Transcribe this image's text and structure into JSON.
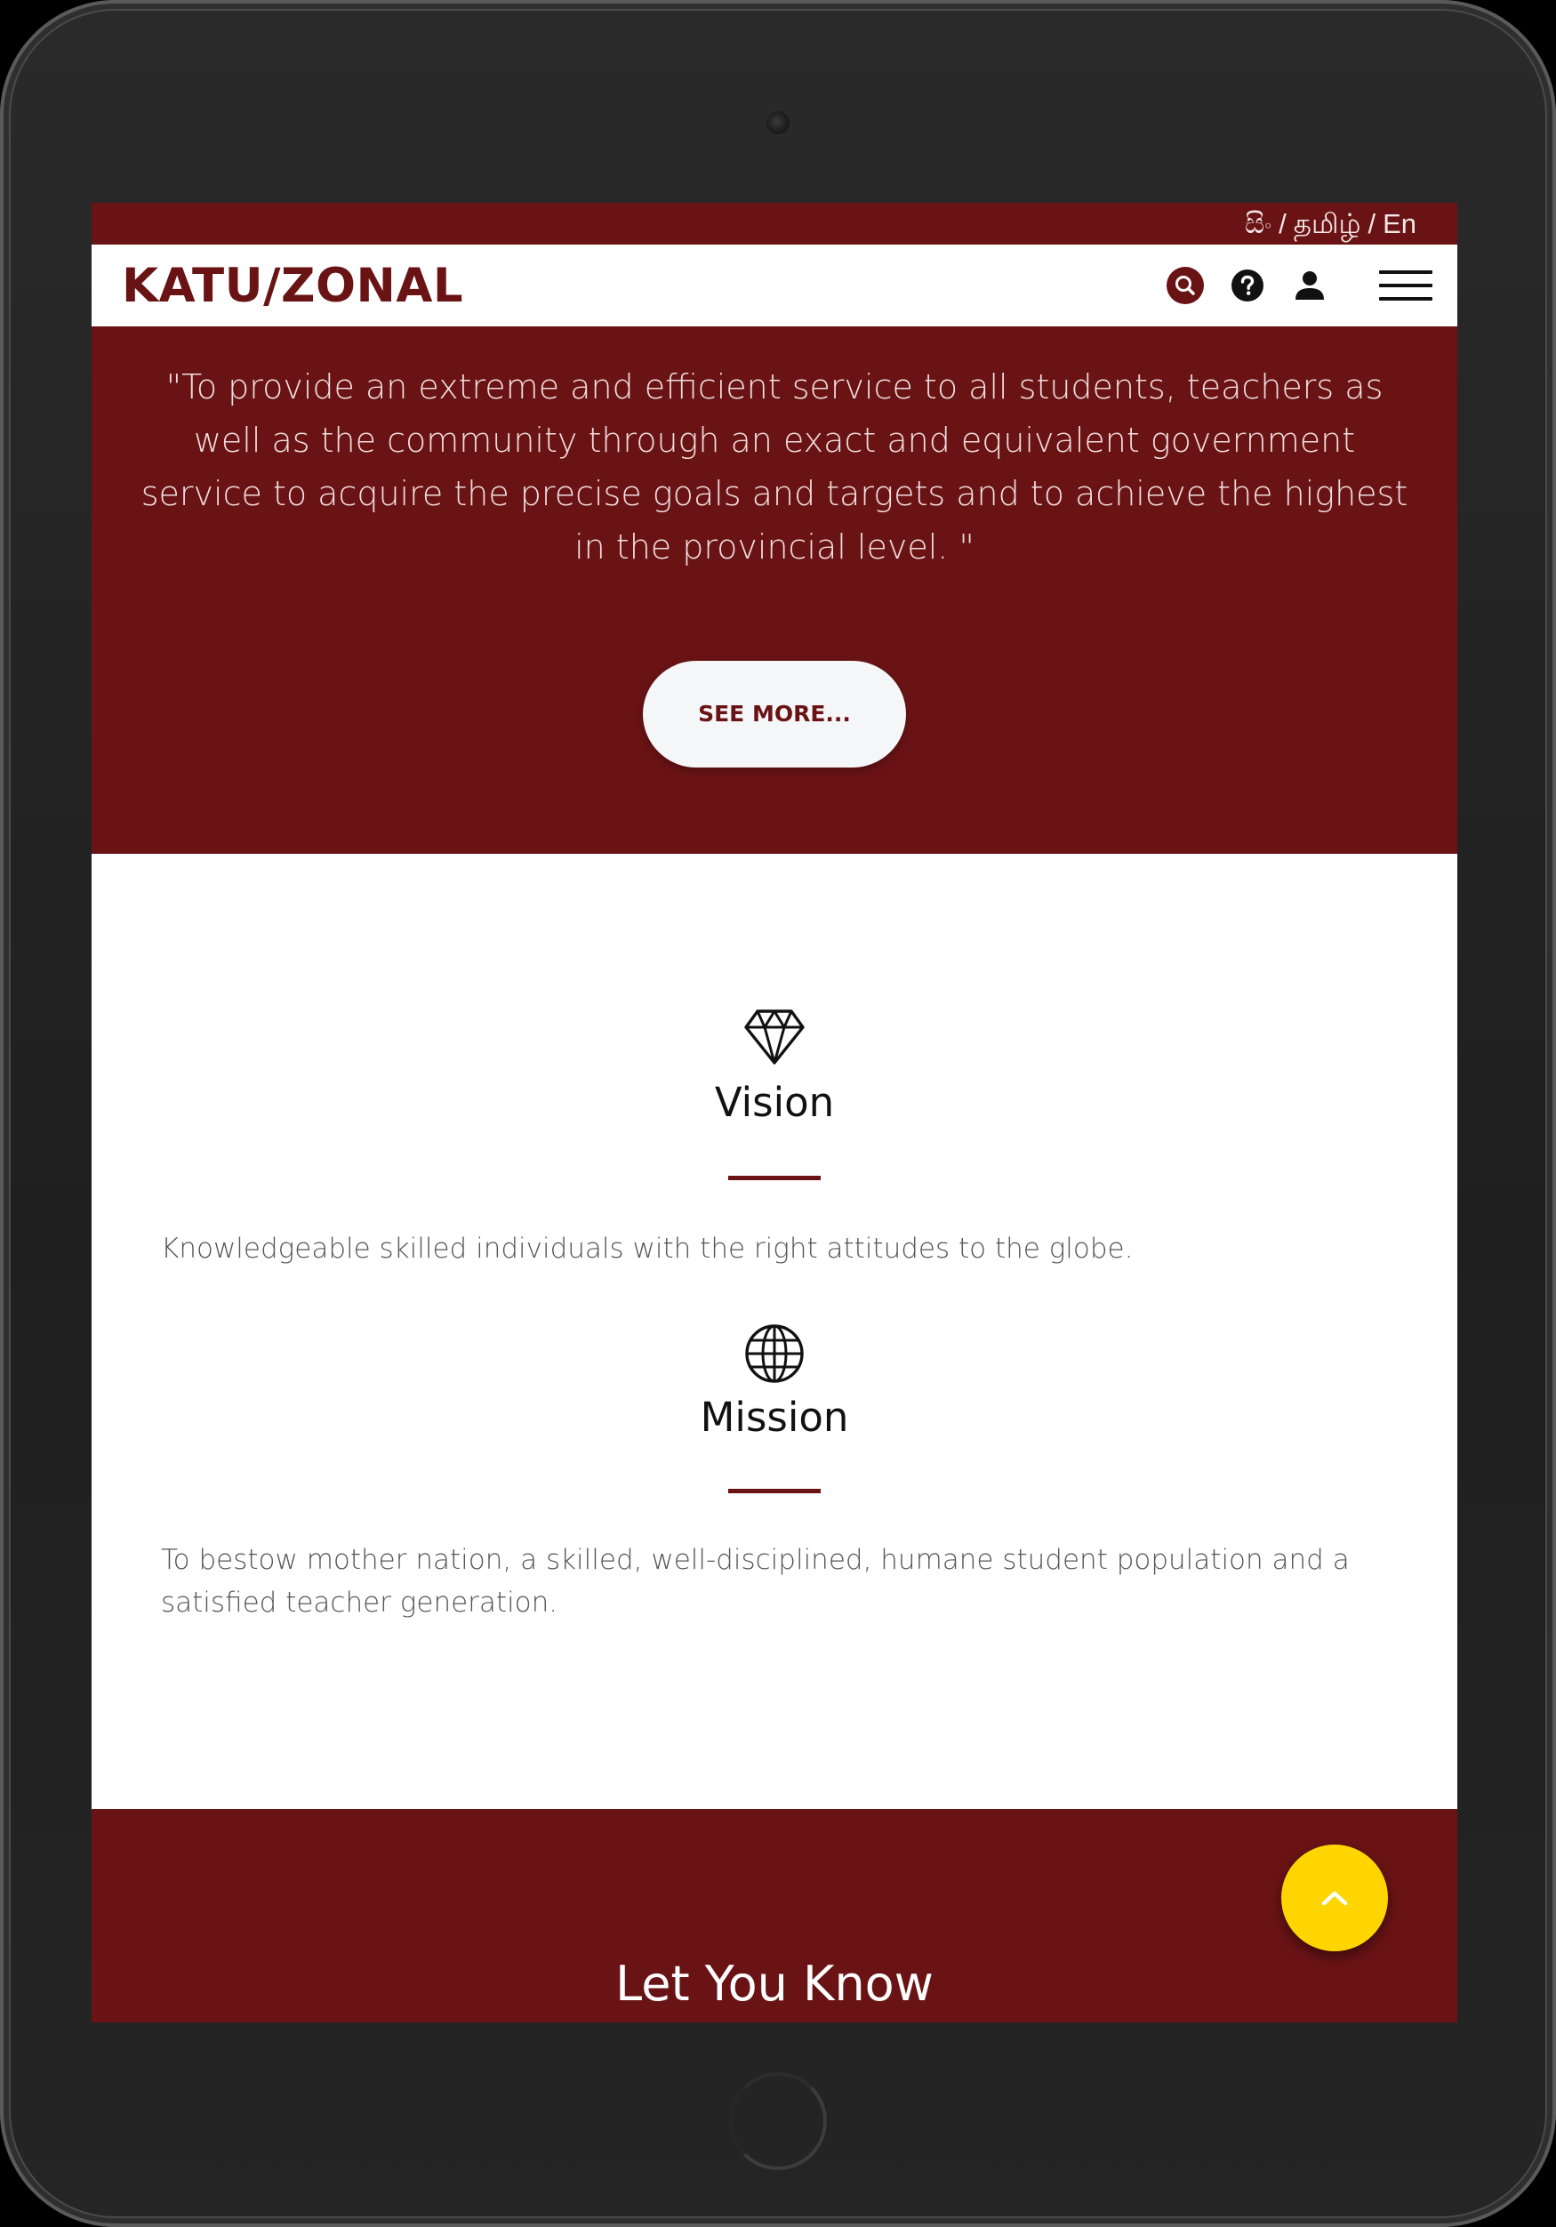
{
  "language_switcher": {
    "sinhala": "සිං",
    "tamil": "தமிழ்",
    "english": "En",
    "separator": "/"
  },
  "navbar": {
    "brand": "KATU/ZONAL",
    "icons": [
      "search-icon",
      "help-icon",
      "user-icon",
      "hamburger-menu-icon"
    ]
  },
  "hero": {
    "quote": "\"To provide an extreme and efficient service to all students, teachers as well as the community through an exact and equivalent government service to acquire the precise goals and targets and to achieve the highest in the provincial level. \"",
    "button_label": "SEE MORE..."
  },
  "vision": {
    "icon": "diamond-icon",
    "title": "Vision",
    "text": "Knowledgeable skilled individuals with the right attitudes to the globe."
  },
  "mission": {
    "icon": "globe-icon",
    "title": "Mission",
    "text": "To bestow mother nation, a skilled, well-disciplined, humane student population and a satisfied teacher generation."
  },
  "let_you_know": {
    "title": "Let You Know"
  },
  "scroll_top": {
    "icon": "chevron-up-icon"
  },
  "colors": {
    "brand_maroon": "#6a1315",
    "accent_yellow": "#ffd500",
    "device_frame": "#1f1f1f"
  }
}
